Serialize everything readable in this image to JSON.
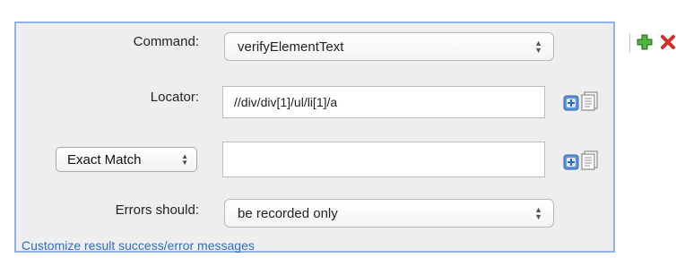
{
  "command": {
    "label": "Command:",
    "value": "verifyElementText"
  },
  "locator": {
    "label": "Locator:",
    "value": "//div/div[1]/ul/li[1]/a"
  },
  "match": {
    "selected": "Exact Match",
    "value": ""
  },
  "errors": {
    "label": "Errors should:",
    "value": "be recorded only"
  },
  "customize_link": "Customize result success/error messages",
  "colors": {
    "panel_border": "#8fb4e3",
    "link": "#2e6fc2",
    "add": "#3a9a2e",
    "remove": "#d0302a"
  },
  "icons": [
    "plus-square-icon",
    "notepad-icon",
    "add-step-icon",
    "delete-step-icon"
  ]
}
